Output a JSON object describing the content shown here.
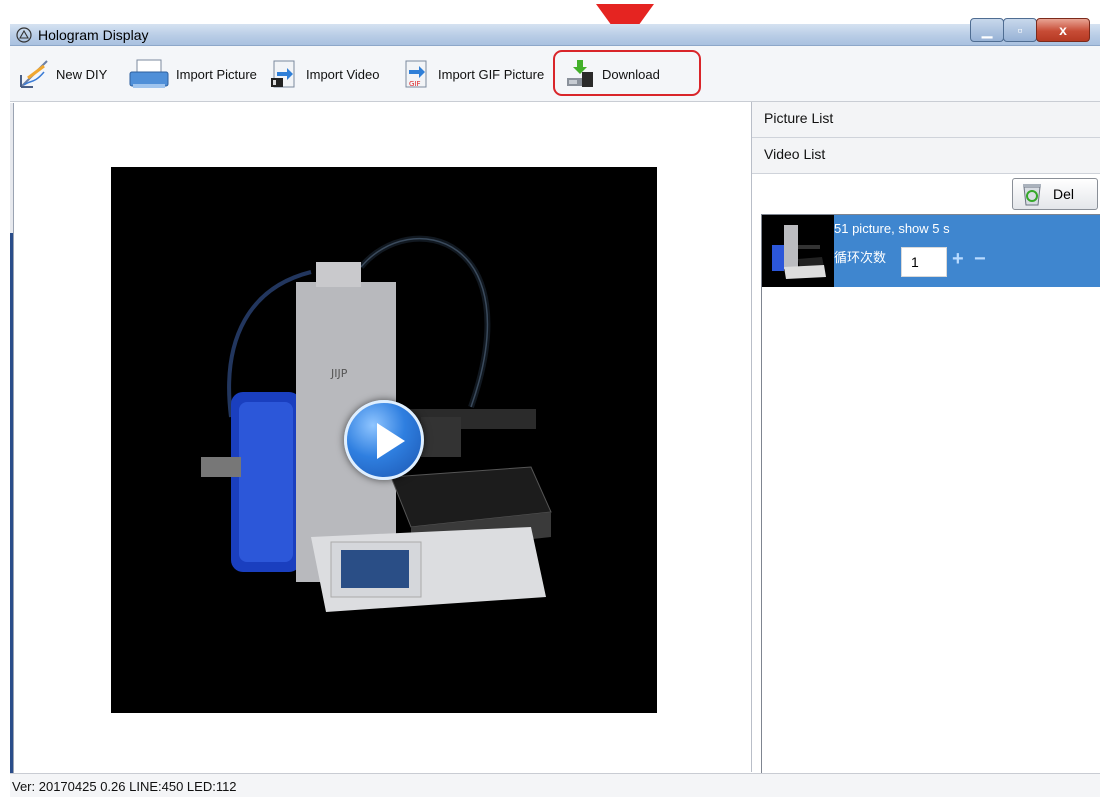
{
  "window": {
    "title": "Hologram Display"
  },
  "toolbar": {
    "new_diy": "New DIY",
    "import_picture": "Import Picture",
    "import_video": "Import Video",
    "import_gif": "Import GIF Picture",
    "download": "Download"
  },
  "panel": {
    "picture_list": "Picture List",
    "video_list": "Video List",
    "del_label": "Del",
    "items": [
      {
        "caption": "51 picture, show 5 s",
        "loop_label": "循环次数",
        "loop_count": "1",
        "plus": "+",
        "minus": "−"
      }
    ]
  },
  "status": {
    "text": "Ver: 20170425  0.26   LINE:450   LED:112"
  },
  "colors": {
    "annotation": "#e52421",
    "selection": "#3f86cf",
    "titlebar": "#b9cde6"
  }
}
